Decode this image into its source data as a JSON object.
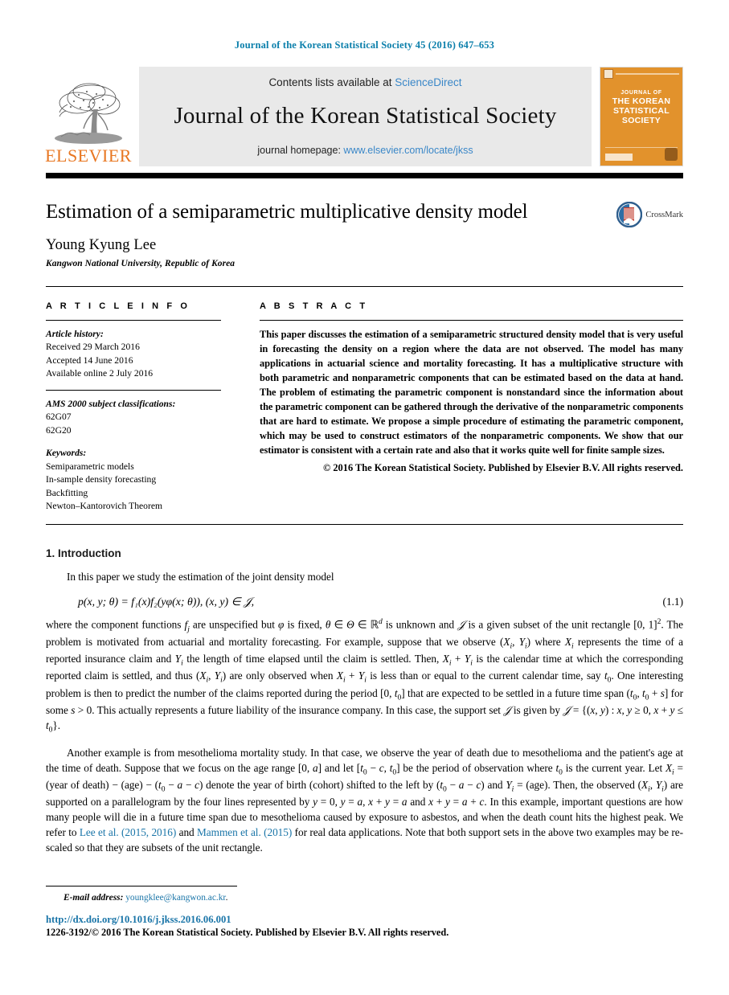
{
  "running_head": "Journal of the Korean Statistical Society 45 (2016) 647–653",
  "masthead": {
    "publisher_name": "ELSEVIER",
    "contents_prefix": "Contents lists available at ",
    "sciencedirect": "ScienceDirect",
    "journal_title": "Journal of the Korean Statistical Society",
    "homepage_prefix": "journal homepage: ",
    "homepage_url": "www.elsevier.com/locate/jkss",
    "cover": {
      "line1": "JOURNAL OF",
      "line2": "THE KOREAN",
      "line3": "STATISTICAL",
      "line4": "SOCIETY"
    }
  },
  "article": {
    "title": "Estimation of a semiparametric multiplicative density model",
    "author": "Young Kyung Lee",
    "affiliation": "Kangwon National University, Republic of Korea",
    "crossmark_label": "CrossMark"
  },
  "info": {
    "heading": "A R T I C L E   I N F O",
    "history_label": "Article history:",
    "received": "Received 29 March 2016",
    "accepted": "Accepted 14 June 2016",
    "available": "Available online 2 July 2016",
    "ams_label": "AMS 2000 subject classifications:",
    "ams_codes": [
      "62G07",
      "62G20"
    ],
    "keywords_label": "Keywords:",
    "keywords": [
      "Semiparametric models",
      "In-sample density forecasting",
      "Backfitting",
      "Newton–Kantorovich Theorem"
    ]
  },
  "abstract": {
    "heading": "A B S T R A C T",
    "body": "This paper discusses the estimation of a semiparametric structured density model that is very useful in forecasting the density on a region where the data are not observed. The model has many applications in actuarial science and mortality forecasting. It has a multiplicative structure with both parametric and nonparametric components that can be estimated based on the data at hand. The problem of estimating the parametric component is nonstandard since the information about the parametric component can be gathered through the derivative of the nonparametric components that are hard to estimate. We propose a simple procedure of estimating the parametric component, which may be used to construct estimators of the nonparametric components. We show that our estimator is consistent with a certain rate and also that it works quite well for finite sample sizes.",
    "copyright": "© 2016 The Korean Statistical Society. Published by Elsevier B.V. All rights reserved."
  },
  "introduction": {
    "number_title": "1. Introduction",
    "lead": "In this paper we study the estimation of the joint density model",
    "equation": "p(x, y; θ) = f₁(x)f₂(yφ(x; θ)),    (x, y) ∈ 𝒥,",
    "equation_number": "(1.1)",
    "para1_a": "where the component functions ",
    "para1_fj": "f",
    "para1_b": " are unspecified but ",
    "para1_phi": "φ",
    "para1_c": " is fixed, ",
    "para1_theta": "θ ∈ Θ ∈ ℝ",
    "para1_d": " is unknown and 𝒥 is a given subset of the unit rectangle [0, 1]",
    "para1_rest": ". The problem is motivated from actuarial and mortality forecasting. For example, suppose that we observe (X",
    "para2_start": "Another example is from mesothelioma mortality study. In that case, we observe the year of death due to mesothelioma and the patient's age at the time of death. Suppose that we focus on the age range [0, a] and let [t₀ − c, t₀] be the period of observation where t₀ is the current year. Let X",
    "citation1": "Lee et al. (2015, 2016)",
    "citation2": "Mammen et al. (2015)"
  },
  "footer": {
    "email_label": "E-mail address:",
    "email": "youngklee@kangwon.ac.kr",
    "email_period": ".",
    "doi": "http://dx.doi.org/10.1016/j.jkss.2016.06.001",
    "issn": "1226-3192/© 2016 The Korean Statistical Society.  Published by Elsevier B.V. All rights reserved."
  },
  "colors": {
    "link_blue": "#1a75a8",
    "header_blue": "#0b7fab",
    "elsevier_orange": "#e87722",
    "cover_orange": "#e2922c",
    "banner_gray": "#e9e9e9"
  }
}
